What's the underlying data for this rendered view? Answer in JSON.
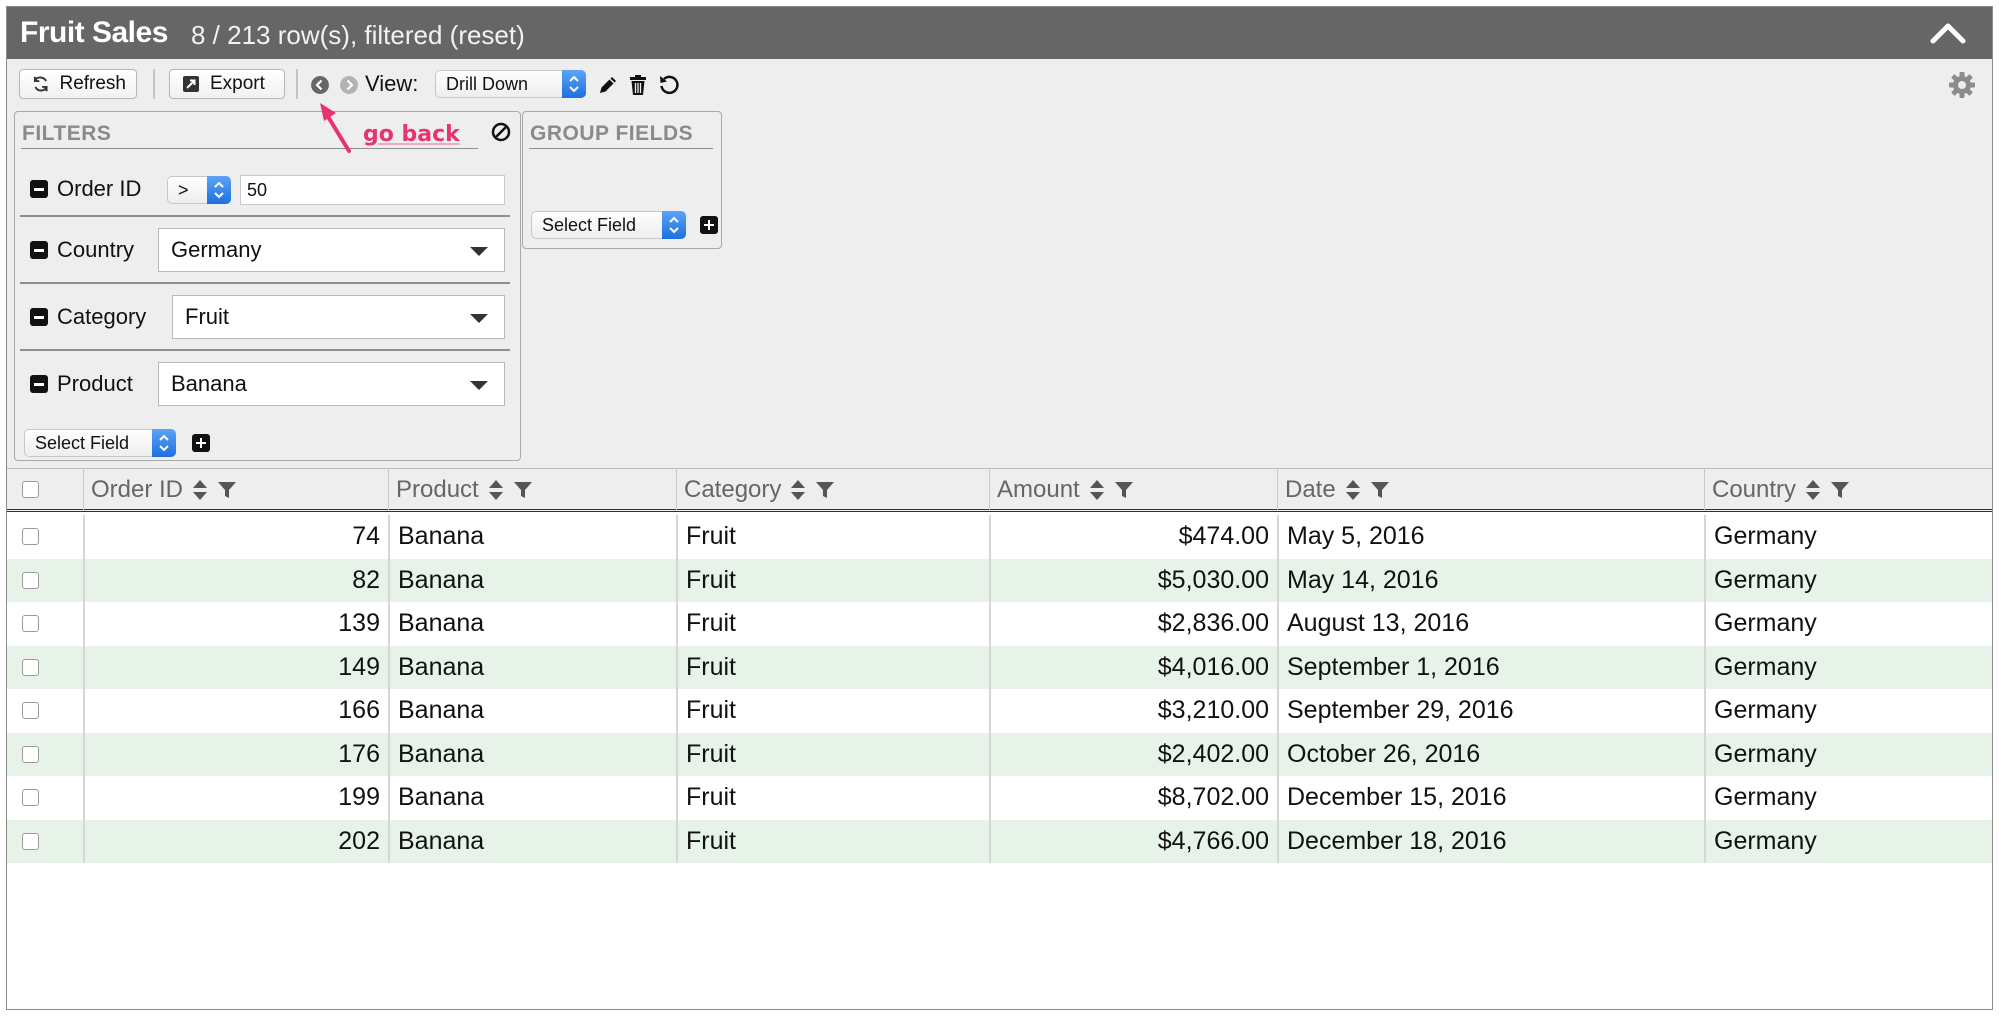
{
  "title": {
    "main": "Fruit Sales",
    "sub": "8 / 213 row(s), filtered (reset)"
  },
  "toolbar": {
    "refresh_label": "Refresh",
    "export_label": "Export",
    "view_label": "View:",
    "view_value": "Drill Down",
    "icons": [
      "back-arrow-icon",
      "forward-arrow-icon",
      "pencil-icon",
      "trash-icon",
      "undo-icon",
      "gear-icon"
    ]
  },
  "annotation": {
    "text": "go back",
    "color": "#e8336d"
  },
  "filters": {
    "title": "FILTERS",
    "rows": [
      {
        "label": "Order ID",
        "operator": ">",
        "value": "50"
      },
      {
        "label": "Country",
        "value": "Germany"
      },
      {
        "label": "Category",
        "value": "Fruit"
      },
      {
        "label": "Product",
        "value": "Banana"
      }
    ],
    "select_field": "Select Field"
  },
  "group_fields": {
    "title": "GROUP FIELDS",
    "select_field": "Select Field"
  },
  "grid": {
    "columns": [
      "Order ID",
      "Product",
      "Category",
      "Amount",
      "Date",
      "Country"
    ],
    "rows": [
      [
        "74",
        "Banana",
        "Fruit",
        "$474.00",
        "May 5, 2016",
        "Germany"
      ],
      [
        "82",
        "Banana",
        "Fruit",
        "$5,030.00",
        "May 14, 2016",
        "Germany"
      ],
      [
        "139",
        "Banana",
        "Fruit",
        "$2,836.00",
        "August 13, 2016",
        "Germany"
      ],
      [
        "149",
        "Banana",
        "Fruit",
        "$4,016.00",
        "September 1, 2016",
        "Germany"
      ],
      [
        "166",
        "Banana",
        "Fruit",
        "$3,210.00",
        "September 29, 2016",
        "Germany"
      ],
      [
        "176",
        "Banana",
        "Fruit",
        "$2,402.00",
        "October 26, 2016",
        "Germany"
      ],
      [
        "199",
        "Banana",
        "Fruit",
        "$8,702.00",
        "December 15, 2016",
        "Germany"
      ],
      [
        "202",
        "Banana",
        "Fruit",
        "$4,766.00",
        "December 18, 2016",
        "Germany"
      ]
    ]
  },
  "colors": {
    "titlebar": "#666666",
    "row_alt": "#e7f3e8",
    "accent_blue": "#1f6fe0"
  }
}
